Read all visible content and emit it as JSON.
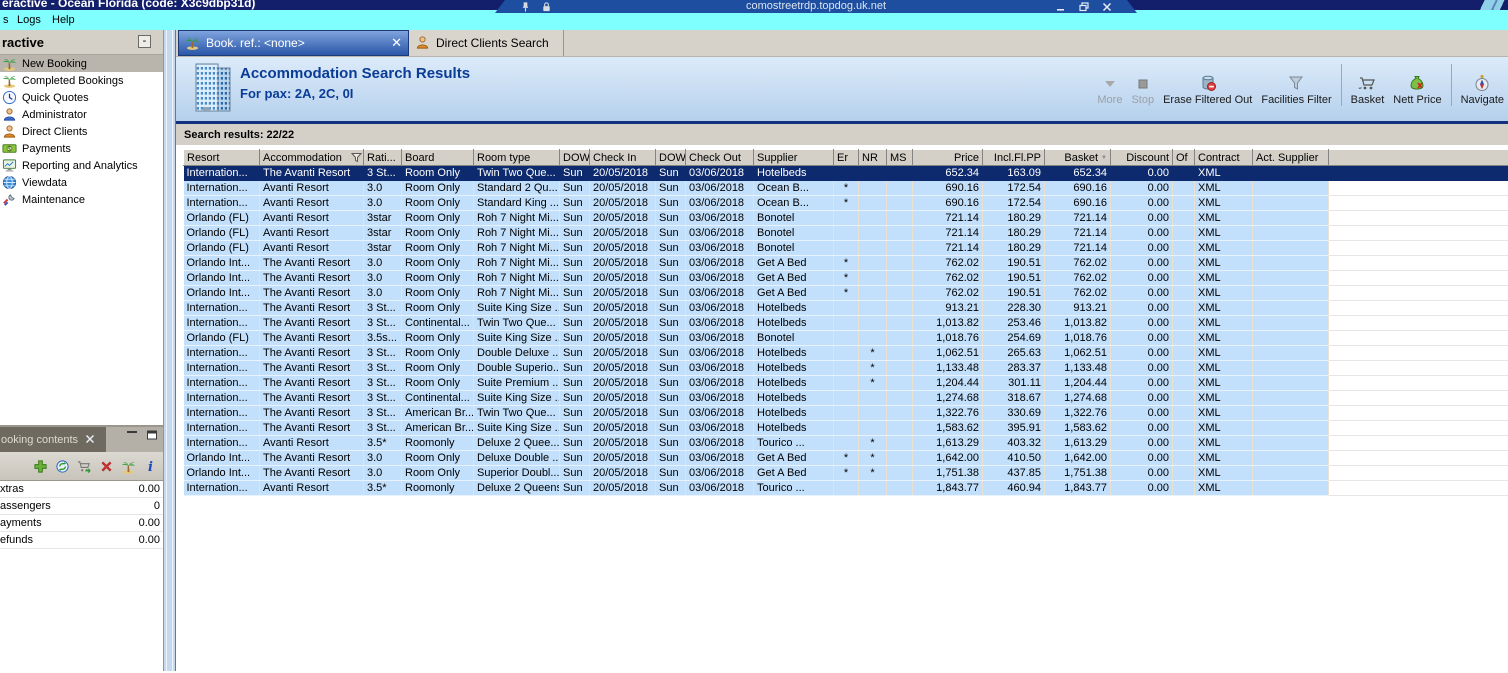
{
  "window": {
    "title": "eractive - Ocean Florida (code: X3c9dbp31d)",
    "rdp_bar": {
      "address": "comostreetrdp.topdog.uk.net",
      "left_icons": [
        "pin",
        "lock"
      ],
      "buttons": [
        "minimize",
        "restore",
        "close"
      ]
    }
  },
  "menu": {
    "items": [
      "s",
      "Logs",
      "Help"
    ]
  },
  "sidebar": {
    "title": "ractive",
    "collapse_label": "-",
    "items": [
      {
        "label": "New Booking",
        "icon": "palm-tree",
        "selected": true
      },
      {
        "label": "Completed Bookings",
        "icon": "palm-tree",
        "selected": false
      },
      {
        "label": "Quick Quotes",
        "icon": "clock",
        "selected": false
      },
      {
        "label": "Administrator",
        "icon": "person-blue",
        "selected": false
      },
      {
        "label": "Direct Clients",
        "icon": "person-orange",
        "selected": false
      },
      {
        "label": "Payments",
        "icon": "money",
        "selected": false
      },
      {
        "label": "Reporting and Analytics",
        "icon": "monitor",
        "selected": false
      },
      {
        "label": "Viewdata",
        "icon": "globe",
        "selected": false
      },
      {
        "label": "Maintenance",
        "icon": "wrench",
        "selected": false
      }
    ]
  },
  "booking_contents": {
    "tab_label": "ooking contents",
    "close_label": "x",
    "toolbar_icons": [
      "add",
      "refresh",
      "cart-add",
      "delete",
      "palm-tree",
      "info"
    ],
    "rows": [
      {
        "label": "xtras",
        "value": "0.00"
      },
      {
        "label": "assengers",
        "value": "0"
      },
      {
        "label": "ayments",
        "value": "0.00"
      },
      {
        "label": "efunds",
        "value": "0.00"
      }
    ]
  },
  "tabs": [
    {
      "label": "Book. ref.: <none>",
      "icon": "palm-tree",
      "active": true,
      "closable": true
    },
    {
      "label": "Direct Clients Search",
      "icon": "person-orange",
      "active": false,
      "closable": false
    }
  ],
  "header": {
    "icon": "building",
    "title": "Accommodation Search Results",
    "subtitle": "For pax: 2A, 2C, 0I"
  },
  "toolbar": {
    "buttons": [
      {
        "label": "More",
        "icon": "more-arrow",
        "disabled": true
      },
      {
        "label": "Stop",
        "icon": "stop-square",
        "disabled": true
      },
      {
        "label": "Erase Filtered Out",
        "icon": "erase-bucket",
        "disabled": false
      },
      {
        "label": "Facilities Filter",
        "icon": "facilities-funnel",
        "disabled": false
      },
      {
        "label": "Basket",
        "icon": "basket-cart",
        "disabled": false
      },
      {
        "label": "Nett Price",
        "icon": "nett-price-bag",
        "disabled": false
      },
      {
        "label": "Navigate",
        "icon": "navigate-compass",
        "disabled": false
      }
    ]
  },
  "results": {
    "summary": "Search results: 22/22",
    "columns": [
      "Resort",
      "Accommodation",
      "Rati...",
      "Board",
      "Room type",
      "DOW",
      "Check In",
      "DOW",
      "Check Out",
      "Supplier",
      "Er",
      "NR",
      "MS",
      "Price",
      "Incl.Fl.PP",
      "Basket",
      "Discount",
      "Of",
      "Contract",
      "Act. Supplier"
    ],
    "filtered_column": "Accommodation",
    "sorted_column": "Basket",
    "selected_row_index": 0,
    "rows": [
      [
        "Internation...",
        "The Avanti Resort",
        "3 St...",
        "Room Only",
        "Twin Two Que...",
        "Sun",
        "20/05/2018",
        "Sun",
        "03/06/2018",
        "Hotelbeds",
        "",
        "",
        "",
        "652.34",
        "163.09",
        "652.34",
        "0.00",
        "",
        "XML",
        ""
      ],
      [
        "Internation...",
        "Avanti Resort",
        "3.0",
        "Room Only",
        "Standard 2 Qu...",
        "Sun",
        "20/05/2018",
        "Sun",
        "03/06/2018",
        "Ocean B...",
        "*",
        "",
        "",
        "690.16",
        "172.54",
        "690.16",
        "0.00",
        "",
        "XML",
        ""
      ],
      [
        "Internation...",
        "Avanti Resort",
        "3.0",
        "Room Only",
        "Standard King ...",
        "Sun",
        "20/05/2018",
        "Sun",
        "03/06/2018",
        "Ocean B...",
        "*",
        "",
        "",
        "690.16",
        "172.54",
        "690.16",
        "0.00",
        "",
        "XML",
        ""
      ],
      [
        "Orlando (FL)",
        "Avanti Resort",
        "3star",
        "Room Only",
        "Roh 7 Night Mi...",
        "Sun",
        "20/05/2018",
        "Sun",
        "03/06/2018",
        "Bonotel",
        "",
        "",
        "",
        "721.14",
        "180.29",
        "721.14",
        "0.00",
        "",
        "XML",
        ""
      ],
      [
        "Orlando (FL)",
        "Avanti Resort",
        "3star",
        "Room Only",
        "Roh 7 Night Mi...",
        "Sun",
        "20/05/2018",
        "Sun",
        "03/06/2018",
        "Bonotel",
        "",
        "",
        "",
        "721.14",
        "180.29",
        "721.14",
        "0.00",
        "",
        "XML",
        ""
      ],
      [
        "Orlando (FL)",
        "Avanti Resort",
        "3star",
        "Room Only",
        "Roh 7 Night Mi...",
        "Sun",
        "20/05/2018",
        "Sun",
        "03/06/2018",
        "Bonotel",
        "",
        "",
        "",
        "721.14",
        "180.29",
        "721.14",
        "0.00",
        "",
        "XML",
        ""
      ],
      [
        "Orlando Int...",
        "The Avanti Resort",
        "3.0",
        "Room Only",
        "Roh 7 Night Mi...",
        "Sun",
        "20/05/2018",
        "Sun",
        "03/06/2018",
        "Get A Bed",
        "*",
        "",
        "",
        "762.02",
        "190.51",
        "762.02",
        "0.00",
        "",
        "XML",
        ""
      ],
      [
        "Orlando Int...",
        "The Avanti Resort",
        "3.0",
        "Room Only",
        "Roh 7 Night Mi...",
        "Sun",
        "20/05/2018",
        "Sun",
        "03/06/2018",
        "Get A Bed",
        "*",
        "",
        "",
        "762.02",
        "190.51",
        "762.02",
        "0.00",
        "",
        "XML",
        ""
      ],
      [
        "Orlando Int...",
        "The Avanti Resort",
        "3.0",
        "Room Only",
        "Roh 7 Night Mi...",
        "Sun",
        "20/05/2018",
        "Sun",
        "03/06/2018",
        "Get A Bed",
        "*",
        "",
        "",
        "762.02",
        "190.51",
        "762.02",
        "0.00",
        "",
        "XML",
        ""
      ],
      [
        "Internation...",
        "The Avanti Resort",
        "3 St...",
        "Room Only",
        "Suite King Size ...",
        "Sun",
        "20/05/2018",
        "Sun",
        "03/06/2018",
        "Hotelbeds",
        "",
        "",
        "",
        "913.21",
        "228.30",
        "913.21",
        "0.00",
        "",
        "XML",
        ""
      ],
      [
        "Internation...",
        "The Avanti Resort",
        "3 St...",
        "Continental...",
        "Twin Two Que...",
        "Sun",
        "20/05/2018",
        "Sun",
        "03/06/2018",
        "Hotelbeds",
        "",
        "",
        "",
        "1,013.82",
        "253.46",
        "1,013.82",
        "0.00",
        "",
        "XML",
        ""
      ],
      [
        "Orlando (FL)",
        "The Avanti Resort",
        "3.5s...",
        "Room Only",
        "Suite King Size ...",
        "Sun",
        "20/05/2018",
        "Sun",
        "03/06/2018",
        "Bonotel",
        "",
        "",
        "",
        "1,018.76",
        "254.69",
        "1,018.76",
        "0.00",
        "",
        "XML",
        ""
      ],
      [
        "Internation...",
        "The Avanti Resort",
        "3 St...",
        "Room Only",
        "Double Deluxe ...",
        "Sun",
        "20/05/2018",
        "Sun",
        "03/06/2018",
        "Hotelbeds",
        "",
        "*",
        "",
        "1,062.51",
        "265.63",
        "1,062.51",
        "0.00",
        "",
        "XML",
        ""
      ],
      [
        "Internation...",
        "The Avanti Resort",
        "3 St...",
        "Room Only",
        "Double Superio...",
        "Sun",
        "20/05/2018",
        "Sun",
        "03/06/2018",
        "Hotelbeds",
        "",
        "*",
        "",
        "1,133.48",
        "283.37",
        "1,133.48",
        "0.00",
        "",
        "XML",
        ""
      ],
      [
        "Internation...",
        "The Avanti Resort",
        "3 St...",
        "Room Only",
        "Suite Premium ...",
        "Sun",
        "20/05/2018",
        "Sun",
        "03/06/2018",
        "Hotelbeds",
        "",
        "*",
        "",
        "1,204.44",
        "301.11",
        "1,204.44",
        "0.00",
        "",
        "XML",
        ""
      ],
      [
        "Internation...",
        "The Avanti Resort",
        "3 St...",
        "Continental...",
        "Suite King Size ...",
        "Sun",
        "20/05/2018",
        "Sun",
        "03/06/2018",
        "Hotelbeds",
        "",
        "",
        "",
        "1,274.68",
        "318.67",
        "1,274.68",
        "0.00",
        "",
        "XML",
        ""
      ],
      [
        "Internation...",
        "The Avanti Resort",
        "3 St...",
        "American Br...",
        "Twin Two Que...",
        "Sun",
        "20/05/2018",
        "Sun",
        "03/06/2018",
        "Hotelbeds",
        "",
        "",
        "",
        "1,322.76",
        "330.69",
        "1,322.76",
        "0.00",
        "",
        "XML",
        ""
      ],
      [
        "Internation...",
        "The Avanti Resort",
        "3 St...",
        "American Br...",
        "Suite King Size ...",
        "Sun",
        "20/05/2018",
        "Sun",
        "03/06/2018",
        "Hotelbeds",
        "",
        "",
        "",
        "1,583.62",
        "395.91",
        "1,583.62",
        "0.00",
        "",
        "XML",
        ""
      ],
      [
        "Internation...",
        "Avanti Resort",
        "3.5*",
        "Roomonly",
        "Deluxe 2 Quee...",
        "Sun",
        "20/05/2018",
        "Sun",
        "03/06/2018",
        "Tourico ...",
        "",
        "*",
        "",
        "1,613.29",
        "403.32",
        "1,613.29",
        "0.00",
        "",
        "XML",
        ""
      ],
      [
        "Orlando Int...",
        "The Avanti Resort",
        "3.0",
        "Room Only",
        "Deluxe Double ...",
        "Sun",
        "20/05/2018",
        "Sun",
        "03/06/2018",
        "Get A Bed",
        "*",
        "*",
        "",
        "1,642.00",
        "410.50",
        "1,642.00",
        "0.00",
        "",
        "XML",
        ""
      ],
      [
        "Orlando Int...",
        "The Avanti Resort",
        "3.0",
        "Room Only",
        "Superior Doubl...",
        "Sun",
        "20/05/2018",
        "Sun",
        "03/06/2018",
        "Get A Bed",
        "*",
        "*",
        "",
        "1,751.38",
        "437.85",
        "1,751.38",
        "0.00",
        "",
        "XML",
        ""
      ],
      [
        "Internation...",
        "Avanti Resort",
        "3.5*",
        "Roomonly",
        "Deluxe 2 Queens",
        "Sun",
        "20/05/2018",
        "Sun",
        "03/06/2018",
        "Tourico ...",
        "",
        "",
        "",
        "1,843.77",
        "460.94",
        "1,843.77",
        "0.00",
        "",
        "XML",
        ""
      ]
    ]
  }
}
